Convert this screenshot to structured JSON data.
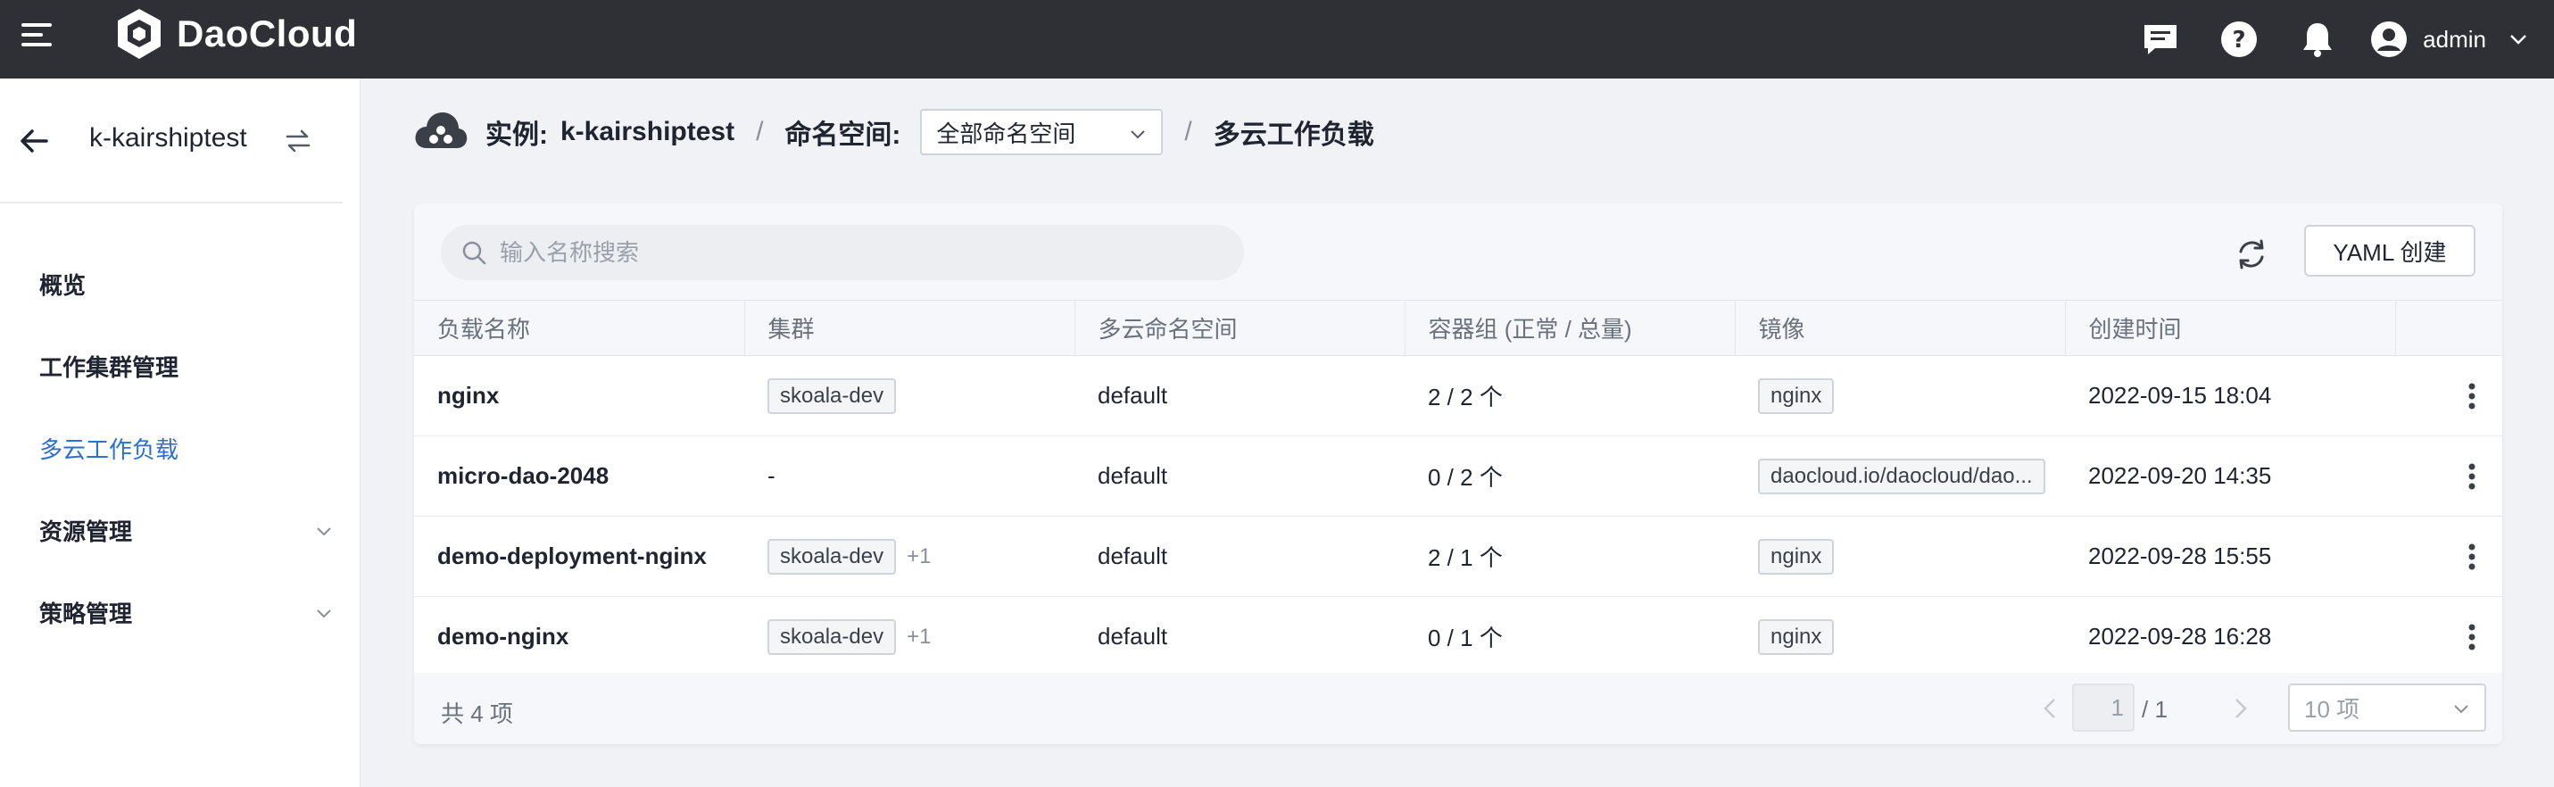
{
  "app": {
    "brand": "DaoCloud",
    "user": "admin"
  },
  "colors": {
    "topbar": "#2f3035",
    "accent": "#2b6fd1"
  },
  "icons": {
    "menu": "hamburger-icon",
    "logo": "daocloud-logo-icon",
    "message": "chat-icon",
    "help": "help-icon",
    "bell": "bell-icon",
    "user": "user-avatar-icon",
    "back": "arrow-left-icon",
    "switch": "switch-icon",
    "refresh": "refresh-icon",
    "more": "more-vertical-icon",
    "search": "search-icon",
    "cloud": "cloud-icon"
  },
  "sidebar": {
    "instance": "k-kairshiptest",
    "items": [
      {
        "label": "概览",
        "active": false,
        "expandable": false
      },
      {
        "label": "工作集群管理",
        "active": false,
        "expandable": false
      },
      {
        "label": "多云工作负载",
        "active": true,
        "expandable": false
      },
      {
        "label": "资源管理",
        "active": false,
        "expandable": true
      },
      {
        "label": "策略管理",
        "active": false,
        "expandable": true
      }
    ]
  },
  "breadcrumb": {
    "instance_label": "实例:",
    "instance_value": "k-kairshiptest",
    "namespace_label": "命名空间:",
    "namespace_selected": "全部命名空间",
    "current": "多云工作负载",
    "separator": "/"
  },
  "toolbar": {
    "search_placeholder": "输入名称搜索",
    "yaml_create": "YAML 创建"
  },
  "table": {
    "columns": [
      "负载名称",
      "集群",
      "多云命名空间",
      "容器组 (正常 / 总量)",
      "镜像",
      "创建时间",
      ""
    ],
    "rows": [
      {
        "name": "nginx",
        "cluster": "skoala-dev",
        "cluster_extra": "",
        "namespace": "default",
        "pods": "2 / 2 个",
        "image": "nginx",
        "created": "2022-09-15 18:04"
      },
      {
        "name": "micro-dao-2048",
        "cluster": "-",
        "cluster_extra": "",
        "namespace": "default",
        "pods": "0 / 2 个",
        "image": "daocloud.io/daocloud/dao...",
        "created": "2022-09-20 14:35"
      },
      {
        "name": "demo-deployment-nginx",
        "cluster": "skoala-dev",
        "cluster_extra": "+1",
        "namespace": "default",
        "pods": "2 / 1 个",
        "image": "nginx",
        "created": "2022-09-28 15:55"
      },
      {
        "name": "demo-nginx",
        "cluster": "skoala-dev",
        "cluster_extra": "+1",
        "namespace": "default",
        "pods": "0 / 1 个",
        "image": "nginx",
        "created": "2022-09-28 16:28"
      }
    ]
  },
  "pagination": {
    "total": "共 4 项",
    "current_page": "1",
    "page_total": "/ 1",
    "page_size": "10 项"
  }
}
